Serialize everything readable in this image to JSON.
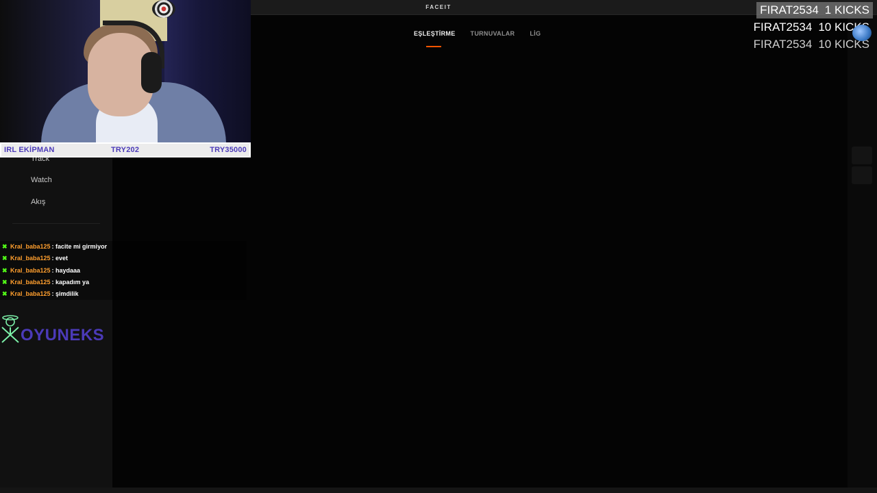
{
  "app": {
    "brand": "FACEIT"
  },
  "sidebar": {
    "items": [
      {
        "label": "Track"
      },
      {
        "label": "Watch"
      },
      {
        "label": "Akış"
      }
    ]
  },
  "main": {
    "tabs": [
      {
        "label": "EŞLEŞTİRME",
        "active": true
      },
      {
        "label": "TURNUVALAR",
        "active": false
      },
      {
        "label": "LİG",
        "active": false
      }
    ],
    "accent_color": "#ff5500"
  },
  "overlay": {
    "webcam_bar": {
      "left": "IRL EKİPMAN",
      "middle": "TRY202",
      "right": "TRY35000"
    },
    "chat": [
      {
        "user": "Kral_baba125",
        "message": ": facite mi girmiyor"
      },
      {
        "user": "Kral_baba125",
        "message": ": evet"
      },
      {
        "user": "Kral_baba125",
        "message": ": haydaaa"
      },
      {
        "user": "Kral_baba125",
        "message": ": kapadım ya"
      },
      {
        "user": "Kral_baba125",
        "message": ": şimdilik"
      }
    ],
    "chat_icon": "kick-logo-icon",
    "logo_text": "OYUNEKS",
    "kicks": [
      {
        "user": "FIRAT2534",
        "amount": "1 KICKS"
      },
      {
        "user": "FIRAT2534",
        "amount": "10 KICKS"
      },
      {
        "user": "FIRAT2534",
        "amount": "10 KICKS"
      }
    ]
  },
  "colors": {
    "chat_username": "#ff9f2e",
    "kick_green": "#53fc18",
    "brand_purple": "#4b3ab8"
  }
}
